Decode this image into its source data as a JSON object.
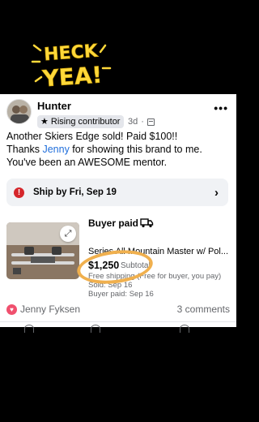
{
  "sticker": {
    "line1": "HECK",
    "line2": "YEA!"
  },
  "post": {
    "author": "Hunter",
    "badge": "Rising contributor",
    "timestamp": "3d",
    "text_line1": "Another Skiers Edge sold! Paid $100!!",
    "text_thanks": "Thanks ",
    "text_mention": "Jenny",
    "text_after_mention": " for showing this brand to me. You've been an AWESOME mentor."
  },
  "ship_banner": {
    "label": "Ship by Fri, Sep 19"
  },
  "item": {
    "status": "Buyer paid",
    "title": "Series All Mountain Master w/ Pol...",
    "price": "$1,250",
    "price_note": "Subtotal",
    "shipping": "Free shipping (Free for buyer, you pay)",
    "sold": "Sold: Sep 16",
    "buyer_paid": "Buyer paid: Sep 16"
  },
  "reactions": {
    "name": "Jenny Fyksen",
    "comments": "3 comments"
  },
  "colors": {
    "accent_yellow": "#ffd83a",
    "highlight_orange": "#f0b04e",
    "mention_blue": "#216fdb",
    "alert_red": "#d5262b",
    "heart_pink": "#f0506e"
  },
  "icons": [
    "star-icon",
    "calendar-icon",
    "more-icon",
    "alert-icon",
    "chevron-right-icon",
    "expand-icon",
    "truck-icon",
    "heart-icon"
  ]
}
